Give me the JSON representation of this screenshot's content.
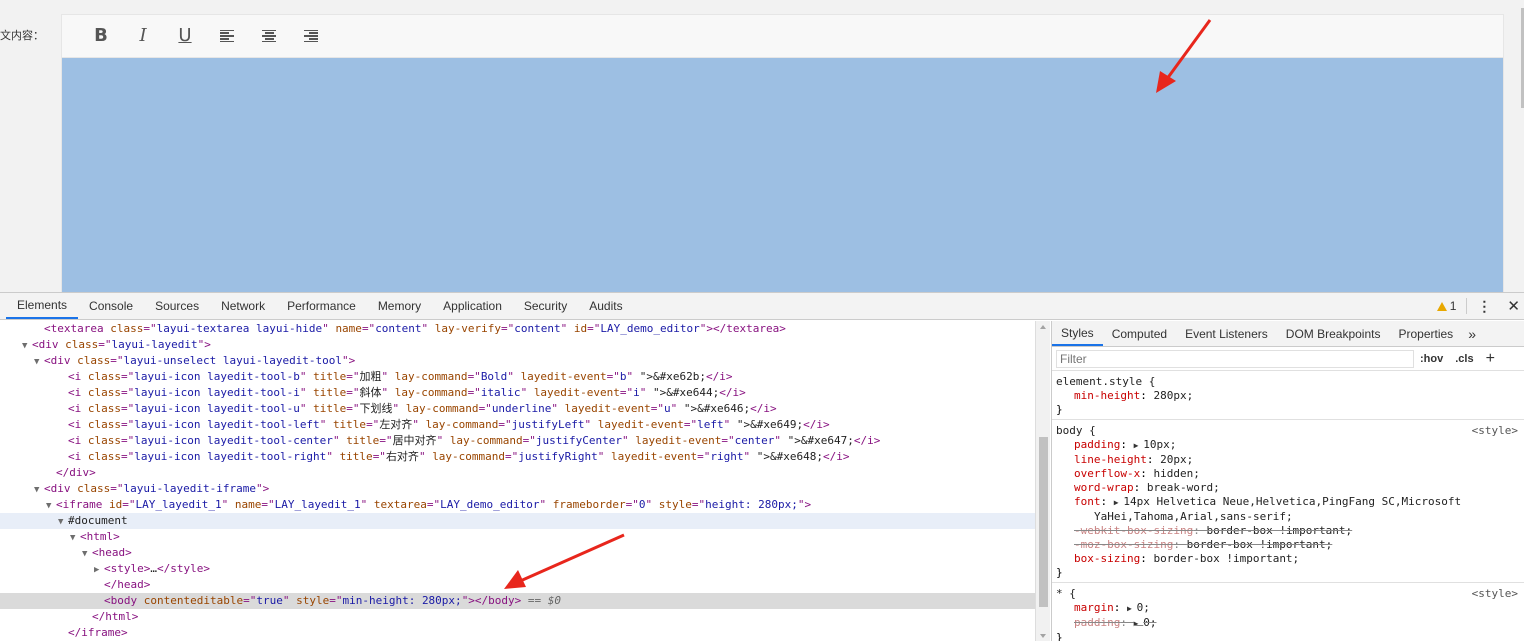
{
  "page": {
    "field_label": "文内容：",
    "toolbar": {
      "bold": "B",
      "italic": "I",
      "underline": "U"
    },
    "editor_bg": "#9dbfe3"
  },
  "devtools": {
    "tabs": [
      "Elements",
      "Console",
      "Sources",
      "Network",
      "Performance",
      "Memory",
      "Application",
      "Security",
      "Audits"
    ],
    "active_tab": "Elements",
    "warning_count": "1",
    "accent_color": "#1a73e8",
    "elements_lines": [
      {
        "indent": 2,
        "twisty": "",
        "parts": [
          [
            "tg",
            "<textarea "
          ],
          [
            "an",
            "class"
          ],
          [
            "tg",
            "=\""
          ],
          [
            "av",
            "layui-textarea layui-hide"
          ],
          [
            "tg",
            "\" "
          ],
          [
            "an",
            "name"
          ],
          [
            "tg",
            "=\""
          ],
          [
            "av",
            "content"
          ],
          [
            "tg",
            "\" "
          ],
          [
            "an",
            "lay-verify"
          ],
          [
            "tg",
            "=\""
          ],
          [
            "av",
            "content"
          ],
          [
            "tg",
            "\" "
          ],
          [
            "an",
            "id"
          ],
          [
            "tg",
            "=\""
          ],
          [
            "av",
            "LAY_demo_editor"
          ],
          [
            "tg",
            "\"></textarea>"
          ]
        ]
      },
      {
        "indent": 1,
        "twisty": "▼",
        "parts": [
          [
            "tg",
            "<div "
          ],
          [
            "an",
            "class"
          ],
          [
            "tg",
            "=\""
          ],
          [
            "av",
            "layui-layedit"
          ],
          [
            "tg",
            "\">"
          ]
        ]
      },
      {
        "indent": 2,
        "twisty": "▼",
        "parts": [
          [
            "tg",
            "<div "
          ],
          [
            "an",
            "class"
          ],
          [
            "tg",
            "=\""
          ],
          [
            "av",
            "layui-unselect layui-layedit-tool"
          ],
          [
            "tg",
            "\">"
          ]
        ]
      },
      {
        "indent": 4,
        "twisty": "",
        "parts": [
          [
            "tg",
            "<i "
          ],
          [
            "an",
            "class"
          ],
          [
            "tg",
            "=\""
          ],
          [
            "av",
            "layui-icon layedit-tool-b"
          ],
          [
            "tg",
            "\" "
          ],
          [
            "an",
            "title"
          ],
          [
            "tg",
            "=\""
          ],
          [
            "tx",
            "加粗"
          ],
          [
            "tg",
            "\" "
          ],
          [
            "an",
            "lay-command"
          ],
          [
            "tg",
            "=\""
          ],
          [
            "av",
            "Bold"
          ],
          [
            "tg",
            "\" "
          ],
          [
            "an",
            "layedit-event"
          ],
          [
            "tg",
            "=\""
          ],
          [
            "av",
            "b"
          ],
          [
            "tg",
            "\" "
          ],
          [
            "tx",
            "\">&#xe62b;"
          ],
          [
            "tg",
            "</i>"
          ]
        ]
      },
      {
        "indent": 4,
        "twisty": "",
        "parts": [
          [
            "tg",
            "<i "
          ],
          [
            "an",
            "class"
          ],
          [
            "tg",
            "=\""
          ],
          [
            "av",
            "layui-icon layedit-tool-i"
          ],
          [
            "tg",
            "\" "
          ],
          [
            "an",
            "title"
          ],
          [
            "tg",
            "=\""
          ],
          [
            "tx",
            "斜体"
          ],
          [
            "tg",
            "\" "
          ],
          [
            "an",
            "lay-command"
          ],
          [
            "tg",
            "=\""
          ],
          [
            "av",
            "italic"
          ],
          [
            "tg",
            "\" "
          ],
          [
            "an",
            "layedit-event"
          ],
          [
            "tg",
            "=\""
          ],
          [
            "av",
            "i"
          ],
          [
            "tg",
            "\" "
          ],
          [
            "tx",
            "\">&#xe644;"
          ],
          [
            "tg",
            "</i>"
          ]
        ]
      },
      {
        "indent": 4,
        "twisty": "",
        "parts": [
          [
            "tg",
            "<i "
          ],
          [
            "an",
            "class"
          ],
          [
            "tg",
            "=\""
          ],
          [
            "av",
            "layui-icon layedit-tool-u"
          ],
          [
            "tg",
            "\" "
          ],
          [
            "an",
            "title"
          ],
          [
            "tg",
            "=\""
          ],
          [
            "tx",
            "下划线"
          ],
          [
            "tg",
            "\" "
          ],
          [
            "an",
            "lay-command"
          ],
          [
            "tg",
            "=\""
          ],
          [
            "av",
            "underline"
          ],
          [
            "tg",
            "\" "
          ],
          [
            "an",
            "layedit-event"
          ],
          [
            "tg",
            "=\""
          ],
          [
            "av",
            "u"
          ],
          [
            "tg",
            "\" "
          ],
          [
            "tx",
            "\">&#xe646;"
          ],
          [
            "tg",
            "</i>"
          ]
        ]
      },
      {
        "indent": 4,
        "twisty": "",
        "parts": [
          [
            "tg",
            "<i "
          ],
          [
            "an",
            "class"
          ],
          [
            "tg",
            "=\""
          ],
          [
            "av",
            "layui-icon layedit-tool-left"
          ],
          [
            "tg",
            "\" "
          ],
          [
            "an",
            "title"
          ],
          [
            "tg",
            "=\""
          ],
          [
            "tx",
            "左对齐"
          ],
          [
            "tg",
            "\" "
          ],
          [
            "an",
            "lay-command"
          ],
          [
            "tg",
            "=\""
          ],
          [
            "av",
            "justifyLeft"
          ],
          [
            "tg",
            "\" "
          ],
          [
            "an",
            "layedit-event"
          ],
          [
            "tg",
            "=\""
          ],
          [
            "av",
            "left"
          ],
          [
            "tg",
            "\" "
          ],
          [
            "tx",
            "\">&#xe649;"
          ],
          [
            "tg",
            "</i>"
          ]
        ]
      },
      {
        "indent": 4,
        "twisty": "",
        "parts": [
          [
            "tg",
            "<i "
          ],
          [
            "an",
            "class"
          ],
          [
            "tg",
            "=\""
          ],
          [
            "av",
            "layui-icon layedit-tool-center"
          ],
          [
            "tg",
            "\" "
          ],
          [
            "an",
            "title"
          ],
          [
            "tg",
            "=\""
          ],
          [
            "tx",
            "居中对齐"
          ],
          [
            "tg",
            "\" "
          ],
          [
            "an",
            "lay-command"
          ],
          [
            "tg",
            "=\""
          ],
          [
            "av",
            "justifyCenter"
          ],
          [
            "tg",
            "\" "
          ],
          [
            "an",
            "layedit-event"
          ],
          [
            "tg",
            "=\""
          ],
          [
            "av",
            "center"
          ],
          [
            "tg",
            "\" "
          ],
          [
            "tx",
            "\">&#xe647;"
          ],
          [
            "tg",
            "</i>"
          ]
        ]
      },
      {
        "indent": 4,
        "twisty": "",
        "parts": [
          [
            "tg",
            "<i "
          ],
          [
            "an",
            "class"
          ],
          [
            "tg",
            "=\""
          ],
          [
            "av",
            "layui-icon layedit-tool-right"
          ],
          [
            "tg",
            "\" "
          ],
          [
            "an",
            "title"
          ],
          [
            "tg",
            "=\""
          ],
          [
            "tx",
            "右对齐"
          ],
          [
            "tg",
            "\" "
          ],
          [
            "an",
            "lay-command"
          ],
          [
            "tg",
            "=\""
          ],
          [
            "av",
            "justifyRight"
          ],
          [
            "tg",
            "\" "
          ],
          [
            "an",
            "layedit-event"
          ],
          [
            "tg",
            "=\""
          ],
          [
            "av",
            "right"
          ],
          [
            "tg",
            "\" "
          ],
          [
            "tx",
            "\">&#xe648;"
          ],
          [
            "tg",
            "</i>"
          ]
        ]
      },
      {
        "indent": 3,
        "twisty": "",
        "parts": [
          [
            "tg",
            "</div>"
          ]
        ]
      },
      {
        "indent": 2,
        "twisty": "▼",
        "parts": [
          [
            "tg",
            "<div "
          ],
          [
            "an",
            "class"
          ],
          [
            "tg",
            "=\""
          ],
          [
            "av",
            "layui-layedit-iframe"
          ],
          [
            "tg",
            "\">"
          ]
        ]
      },
      {
        "indent": 3,
        "twisty": "▼",
        "parts": [
          [
            "tg",
            "<iframe "
          ],
          [
            "an",
            "id"
          ],
          [
            "tg",
            "=\""
          ],
          [
            "av",
            "LAY_layedit_1"
          ],
          [
            "tg",
            "\" "
          ],
          [
            "an",
            "name"
          ],
          [
            "tg",
            "=\""
          ],
          [
            "av",
            "LAY_layedit_1"
          ],
          [
            "tg",
            "\" "
          ],
          [
            "an",
            "textarea"
          ],
          [
            "tg",
            "=\""
          ],
          [
            "av",
            "LAY_demo_editor"
          ],
          [
            "tg",
            "\" "
          ],
          [
            "an",
            "frameborder"
          ],
          [
            "tg",
            "=\""
          ],
          [
            "av",
            "0"
          ],
          [
            "tg",
            "\" "
          ],
          [
            "an",
            "style"
          ],
          [
            "tg",
            "=\""
          ],
          [
            "av",
            "height: 280px;"
          ],
          [
            "tg",
            "\">"
          ]
        ]
      },
      {
        "indent": 4,
        "twisty": "▼",
        "hover": true,
        "parts": [
          [
            "tx",
            "#document"
          ]
        ]
      },
      {
        "indent": 5,
        "twisty": "▼",
        "parts": [
          [
            "tg",
            "<html>"
          ]
        ]
      },
      {
        "indent": 6,
        "twisty": "▼",
        "parts": [
          [
            "tg",
            "<head>"
          ]
        ]
      },
      {
        "indent": 7,
        "twisty": "▶",
        "parts": [
          [
            "tg",
            "<style>"
          ],
          [
            "tx",
            "…"
          ],
          [
            "tg",
            "</style>"
          ]
        ]
      },
      {
        "indent": 7,
        "twisty": "",
        "parts": [
          [
            "tg",
            "</head>"
          ]
        ]
      },
      {
        "indent": 7,
        "twisty": "",
        "selected": true,
        "parts": [
          [
            "tg",
            "<body "
          ],
          [
            "an",
            "contenteditable"
          ],
          [
            "tg",
            "=\""
          ],
          [
            "av",
            "true"
          ],
          [
            "tg",
            "\" "
          ],
          [
            "an",
            "style"
          ],
          [
            "tg",
            "=\""
          ],
          [
            "av",
            "min-height: 280px;"
          ],
          [
            "tg",
            "\"></body>"
          ],
          [
            "eq0",
            " == $0"
          ]
        ]
      },
      {
        "indent": 6,
        "twisty": "",
        "parts": [
          [
            "tg",
            "</html>"
          ]
        ]
      },
      {
        "indent": 4,
        "twisty": "",
        "parts": [
          [
            "tg",
            "</iframe>"
          ]
        ]
      }
    ],
    "styles_tabs": [
      "Styles",
      "Computed",
      "Event Listeners",
      "DOM Breakpoints",
      "Properties"
    ],
    "styles_more": "»",
    "filter_placeholder": "Filter",
    "hov": ":hov",
    "cls": ".cls",
    "plus": "+",
    "rules": [
      {
        "selector": "element.style {",
        "source": "",
        "decls": [
          {
            "name": "min-height",
            "value": "280px;"
          }
        ]
      },
      {
        "selector": "body {",
        "source": "<style>",
        "decls": [
          {
            "name": "padding",
            "value": "10px;",
            "tri": true
          },
          {
            "name": "line-height",
            "value": "20px;"
          },
          {
            "name": "overflow-x",
            "value": "hidden;"
          },
          {
            "name": "word-wrap",
            "value": "break-word;"
          },
          {
            "name": "font",
            "value": "14px Helvetica Neue,Helvetica,PingFang SC,Microsoft",
            "tri": true
          },
          {
            "cont": "YaHei,Tahoma,Arial,sans-serif;"
          },
          {
            "name": "-webkit-box-sizing",
            "value": "border-box !important;",
            "strike": true
          },
          {
            "name": "-moz-box-sizing",
            "value": "border-box !important;",
            "strike": true
          },
          {
            "name": "box-sizing",
            "value": "border-box !important;"
          }
        ]
      },
      {
        "selector": "* {",
        "source": "<style>",
        "decls": [
          {
            "name": "margin",
            "value": "0;",
            "tri": true
          },
          {
            "name": "padding",
            "value": "0;",
            "tri": true,
            "strike": true
          }
        ]
      }
    ]
  }
}
